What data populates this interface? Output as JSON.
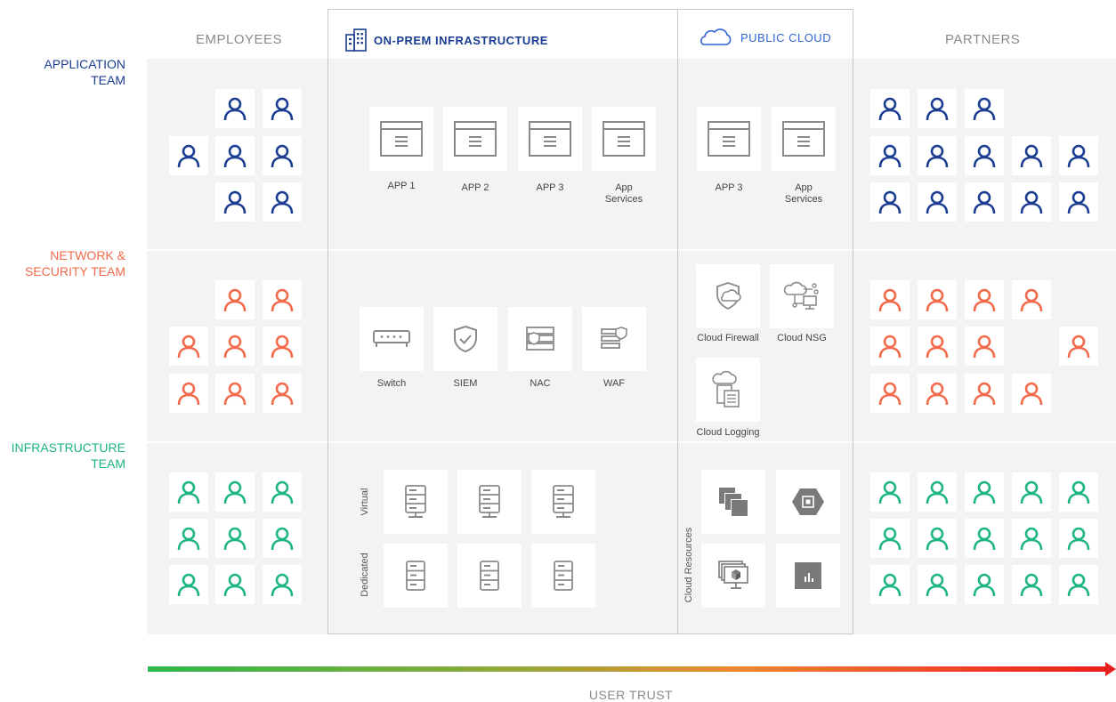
{
  "columns": {
    "employees": "EMPLOYEES",
    "onprem": "ON-PREM INFRASTRUCTURE",
    "cloud": "PUBLIC CLOUD",
    "partners": "PARTNERS"
  },
  "rows": {
    "app_line1": "APPLICATION",
    "app_line2": "TEAM",
    "net_line1": "NETWORK &",
    "net_line2": "SECURITY TEAM",
    "infra_line1": "INFRASTRUCTURE",
    "infra_line2": "TEAM"
  },
  "colors": {
    "application": "#1b3d91",
    "network": "#f26a4a",
    "infrastructure": "#1db581"
  },
  "onprem_apps": [
    {
      "line1": "APP 1",
      "line2": ""
    },
    {
      "line1": "APP 2",
      "line2": ""
    },
    {
      "line1": "APP 3",
      "line2": ""
    },
    {
      "line1": "App",
      "line2": "Services"
    }
  ],
  "cloud_apps": [
    {
      "line1": "APP 3",
      "line2": ""
    },
    {
      "line1": "App",
      "line2": "Services"
    }
  ],
  "onprem_security": [
    "Switch",
    "SIEM",
    "NAC",
    "WAF"
  ],
  "cloud_security": [
    "Cloud Firewall",
    "Cloud NSG",
    "Cloud Logging"
  ],
  "infra_labels": {
    "virtual": "Virtual",
    "dedicated": "Dedicated",
    "cloud_resources": "Cloud Resources"
  },
  "axis_label": "USER TRUST"
}
